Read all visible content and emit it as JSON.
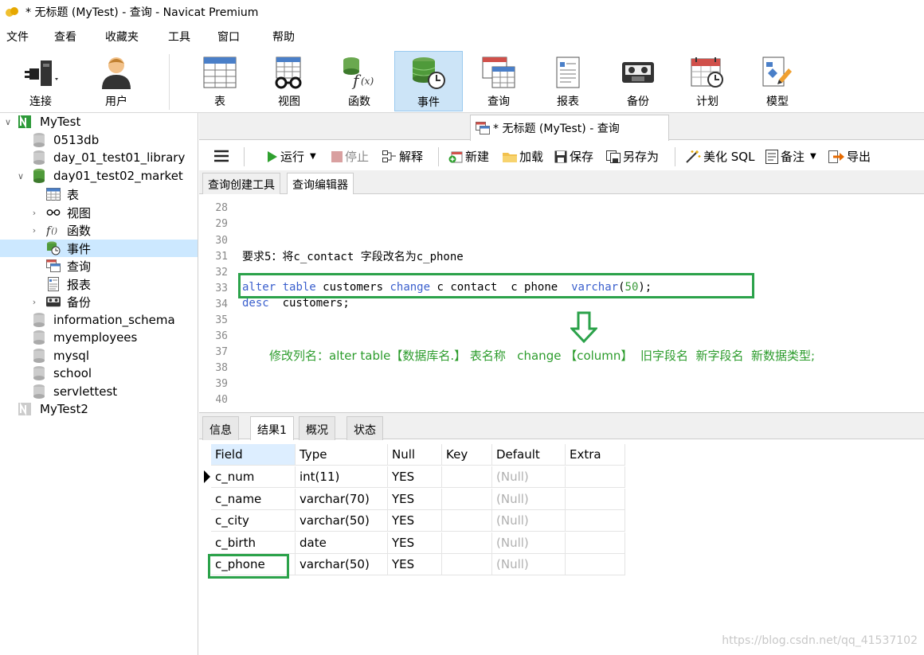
{
  "window": {
    "title": "* 无标题 (MyTest) - 查询 - Navicat Premium"
  },
  "menu": [
    "文件",
    "查看",
    "收藏夹",
    "工具",
    "窗口",
    "帮助"
  ],
  "toolbar": [
    {
      "label": "连接",
      "icon": "plug-icon"
    },
    {
      "label": "用户",
      "icon": "user-icon"
    },
    {
      "label": "表",
      "icon": "table-icon"
    },
    {
      "label": "视图",
      "icon": "view-icon"
    },
    {
      "label": "函数",
      "icon": "function-icon"
    },
    {
      "label": "事件",
      "icon": "event-icon"
    },
    {
      "label": "查询",
      "icon": "query-icon"
    },
    {
      "label": "报表",
      "icon": "report-icon"
    },
    {
      "label": "备份",
      "icon": "backup-icon"
    },
    {
      "label": "计划",
      "icon": "schedule-icon"
    },
    {
      "label": "模型",
      "icon": "model-icon"
    }
  ],
  "sidebar": {
    "items": [
      {
        "label": "MyTest"
      },
      {
        "label": "0513db"
      },
      {
        "label": "day_01_test01_library"
      },
      {
        "label": "day01_test02_market"
      },
      {
        "label": "表"
      },
      {
        "label": "视图"
      },
      {
        "label": "函数"
      },
      {
        "label": "事件"
      },
      {
        "label": "查询"
      },
      {
        "label": "报表"
      },
      {
        "label": "备份"
      },
      {
        "label": "information_schema"
      },
      {
        "label": "myemployees"
      },
      {
        "label": "mysql"
      },
      {
        "label": "school"
      },
      {
        "label": "servlettest"
      },
      {
        "label": "MyTest2"
      }
    ]
  },
  "doc_tab": {
    "label": "* 无标题 (MyTest) - 查询"
  },
  "query_toolbar": {
    "run": "运行",
    "stop": "停止",
    "explain": "解释",
    "new": "新建",
    "load": "加载",
    "save": "保存",
    "save_as": "另存为",
    "beautify": "美化 SQL",
    "note": "备注",
    "export": "导出"
  },
  "sub_tabs": [
    "查询创建工具",
    "查询编辑器"
  ],
  "editor": {
    "lines": [
      "28",
      "29",
      "30",
      "31",
      "32",
      "33",
      "34",
      "35",
      "36",
      "37",
      "38",
      "39",
      "40"
    ],
    "line31": "要求5：将c_contact 字段改名为c_phone",
    "line33": {
      "kw1": "alter",
      "kw2": "table",
      "t1": " customers ",
      "kw3": "change",
      "t2": " c contact  c phone  ",
      "kw4": "varchar",
      "p1": "(",
      "n": "50",
      "p2": ");"
    },
    "line34": {
      "kw": "desc",
      "t": "  customers;"
    },
    "note": "修改列名：alter table【数据库名.】 表名称   change 【column】  旧字段名  新字段名  新数据类型;"
  },
  "result_tabs": [
    "信息",
    "结果1",
    "概况",
    "状态"
  ],
  "grid": {
    "columns": [
      "Field",
      "Type",
      "Null",
      "Key",
      "Default",
      "Extra"
    ],
    "rows": [
      [
        "c_num",
        "int(11)",
        "YES",
        "",
        "(Null)",
        ""
      ],
      [
        "c_name",
        "varchar(70)",
        "YES",
        "",
        "(Null)",
        ""
      ],
      [
        "c_city",
        "varchar(50)",
        "YES",
        "",
        "(Null)",
        ""
      ],
      [
        "c_birth",
        "date",
        "YES",
        "",
        "(Null)",
        ""
      ],
      [
        "c_phone",
        "varchar(50)",
        "YES",
        "",
        "(Null)",
        ""
      ]
    ]
  },
  "watermark": "https://blog.csdn.net/qq_41537102",
  "colors": {
    "annotation_green": "#2ba24a",
    "keyword_blue": "#3a5fcd",
    "selection": "#cce8ff"
  }
}
